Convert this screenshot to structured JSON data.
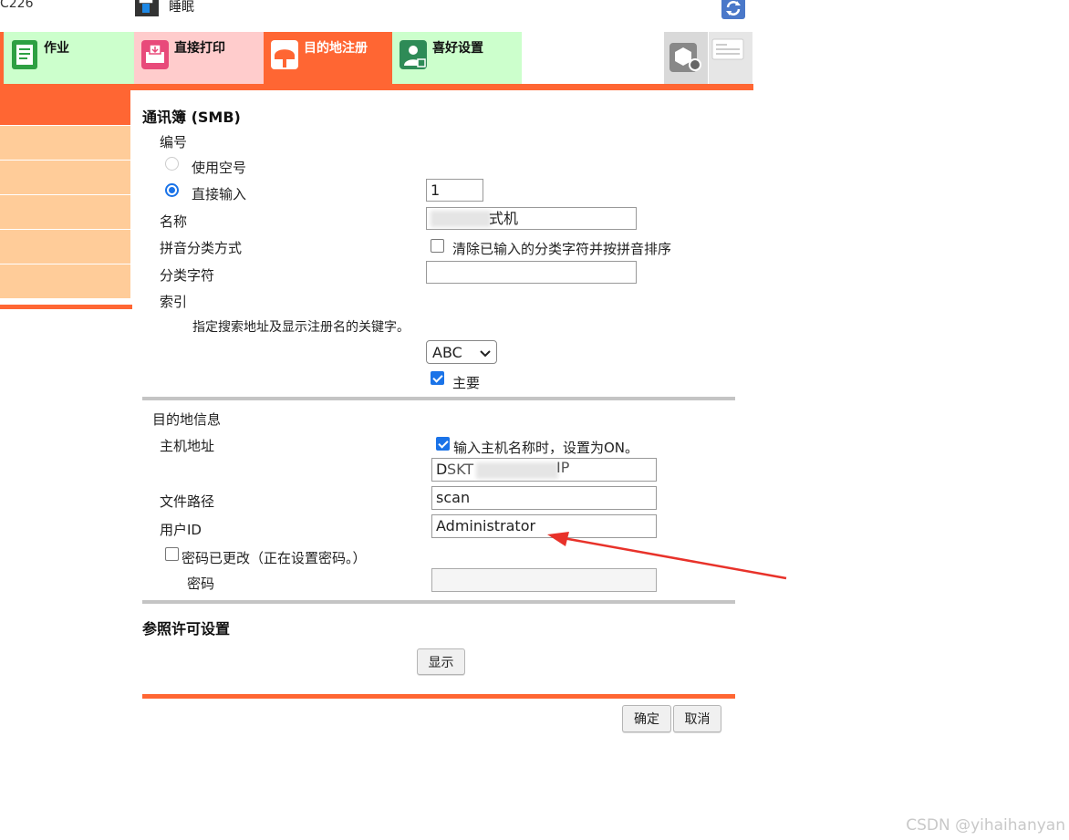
{
  "header": {
    "model_text": "C226",
    "status_text": "睡眠"
  },
  "tabs": [
    {
      "label": "作业",
      "icon": "document-icon"
    },
    {
      "label": "直接打印",
      "icon": "print-icon"
    },
    {
      "label": "目的地注册",
      "icon": "mailbox-icon",
      "active": true
    },
    {
      "label": "喜好设置",
      "icon": "user-settings-icon"
    }
  ],
  "form": {
    "title": "通讯簿 (SMB)",
    "number_label": "编号",
    "use_empty_label": "使用空号",
    "direct_input_label": "直接输入",
    "number_value": "1",
    "name_label": "名称",
    "name_value": "式机",
    "pinyin_label": "拼音分类方式",
    "pinyin_checkbox_label": "清除已输入的分类字符并按拼音排序",
    "category_label": "分类字符",
    "category_value": "",
    "index_label": "索引",
    "index_hint": "指定搜索地址及显示注册名的关键字。",
    "index_select_value": "ABC",
    "primary_label": "主要",
    "dest_info_label": "目的地信息",
    "host_label": "主机地址",
    "host_checkbox_label": "输入主机名称时，设置为ON。",
    "host_value_start": "D",
    "host_value_mid": "SKT",
    "host_value_end": "IP",
    "path_label": "文件路径",
    "path_value": "scan",
    "userid_label": "用户ID",
    "userid_value": "Administrator",
    "pwd_changed_label": "密码已更改（正在设置密码。）",
    "pwd_label": "密码",
    "pwd_value": "",
    "ref_title": "参照许可设置",
    "show_button": "显示"
  },
  "footer": {
    "ok_button": "确定",
    "cancel_button": "取消"
  },
  "watermark": "CSDN @yihaihanyan",
  "colors": {
    "accent": "#ff6633",
    "sidebar": "#ffcc99",
    "annotation_arrow": "#e8322a"
  }
}
